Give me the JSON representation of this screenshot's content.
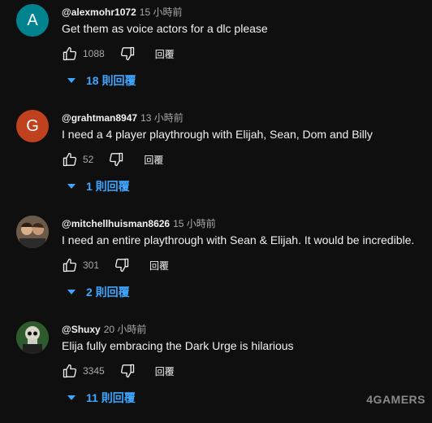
{
  "comments": [
    {
      "avatar_letter": "A",
      "avatar_color": "#00838f",
      "author": "@alexmohr1072",
      "time": "15 小時前",
      "text": "Get them as voice actors for a dlc please",
      "likes": "1088",
      "reply_label": "回覆",
      "replies_label": "18 則回覆"
    },
    {
      "avatar_letter": "G",
      "avatar_color": "#c0411d",
      "author": "@grahtman8947",
      "time": "13 小時前",
      "text": "I need a 4 player playthrough with Elijah, Sean, Dom and Billy",
      "likes": "52",
      "reply_label": "回覆",
      "replies_label": "1 則回覆"
    },
    {
      "avatar_letter": "",
      "avatar_color": "#5a4a3c",
      "author": "@mitchellhuisman8626",
      "time": "15 小時前",
      "text": "I need an entire playthrough with Sean & Elijah. It would be incredible.",
      "likes": "301",
      "reply_label": "回覆",
      "replies_label": "2 則回覆"
    },
    {
      "avatar_letter": "",
      "avatar_color": "#2f5a2e",
      "author": "@Shuxy",
      "time": "20 小時前",
      "text": "Elija fully embracing the Dark Urge is hilarious",
      "likes": "3345",
      "reply_label": "回覆",
      "replies_label": "11 則回覆"
    }
  ],
  "watermark": "4GAMERS"
}
